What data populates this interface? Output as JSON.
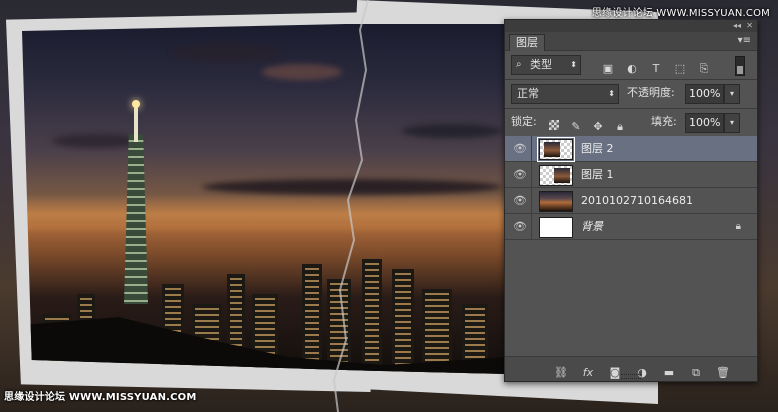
{
  "watermark": {
    "top": "思缘设计论坛  WWW.MISSYUAN.COM",
    "bottom": "思缘设计论坛  WWW.MISSYUAN.COM"
  },
  "panel": {
    "tab_label": "图层",
    "filter": {
      "label": "类型"
    },
    "blend_mode": "正常",
    "opacity_label": "不透明度:",
    "opacity_value": "100%",
    "lock_label": "锁定:",
    "fill_label": "填充:",
    "fill_value": "100%",
    "layers": [
      {
        "name": "图层 2",
        "selected": true
      },
      {
        "name": "图层 1",
        "selected": false
      },
      {
        "name": "2010102710164681",
        "selected": false
      },
      {
        "name": "背景",
        "selected": false,
        "locked": true
      }
    ]
  },
  "colors": {
    "panel_bg": "#535353",
    "selected_layer": "#687082",
    "frame": "#d9d9d9"
  }
}
